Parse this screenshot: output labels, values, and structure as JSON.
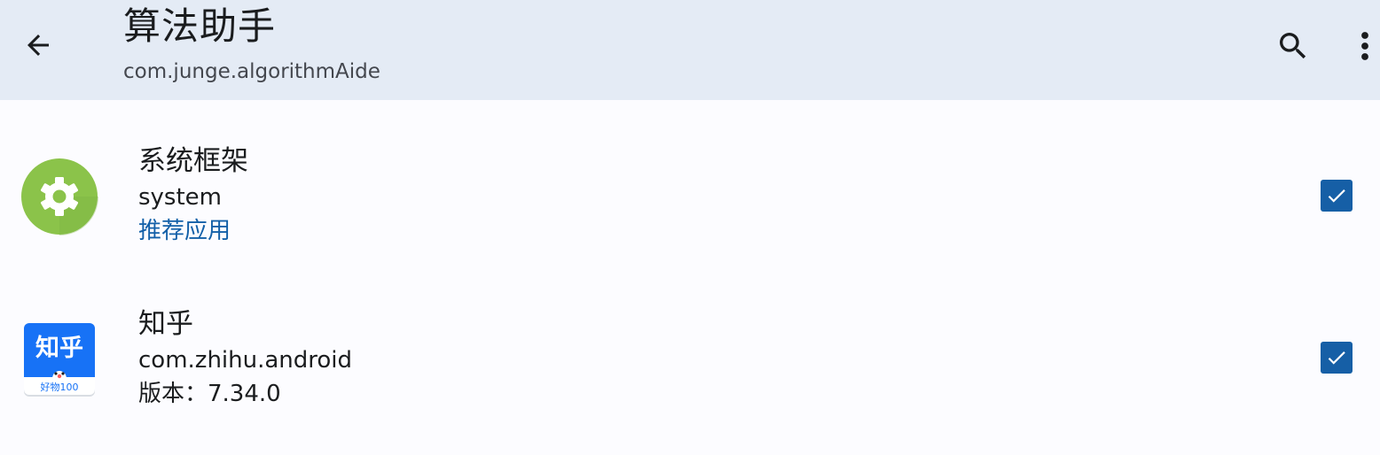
{
  "appbar": {
    "title": "算法助手",
    "subtitle": "com.junge.algorithmAide",
    "back_icon": "arrow-back-icon",
    "search_icon": "search-icon",
    "more_icon": "more-vert-icon"
  },
  "apps": [
    {
      "name": "系统框架",
      "package": "system",
      "extra": "推荐应用",
      "checked": true,
      "icon": "gear-icon",
      "icon_color": "#8bc34a"
    },
    {
      "name": "知乎",
      "package": "com.zhihu.android",
      "extra": "版本：7.34.0",
      "checked": true,
      "icon": "zhihu-logo-icon",
      "icon_color": "#1772f6",
      "icon_text": "知乎",
      "icon_badge": "好物100"
    }
  ],
  "colors": {
    "appbar_bg": "#e4ebf5",
    "page_bg": "#fcfcff",
    "accent": "#165fa6",
    "link": "#1360a8"
  }
}
